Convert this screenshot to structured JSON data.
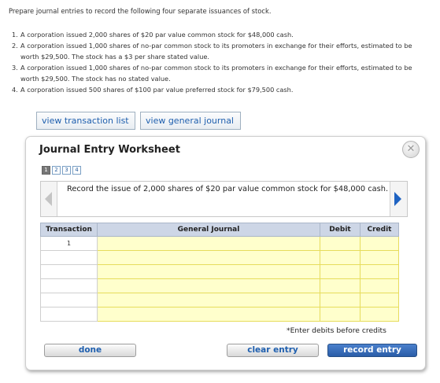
{
  "intro": "Prepare journal entries to record the following four separate issuances of stock.",
  "problems": [
    {
      "num": "1.",
      "text": "A corporation issued 2,000 shares of $20 par value common stock for $48,000 cash."
    },
    {
      "num": "2.",
      "text": "A corporation issued 1,000 shares of no-par common stock to its promoters in exchange for their efforts, estimated to be worth $29,500. The stock has a $3 per share stated value."
    },
    {
      "num": "3.",
      "text": "A corporation issued 1,000 shares of no-par common stock to its promoters in exchange for their efforts, estimated to be worth $29,500. The stock has no stated value."
    },
    {
      "num": "4.",
      "text": "A corporation issued 500 shares of $100 par value preferred stock for $79,500 cash."
    }
  ],
  "buttons": {
    "view_transaction_list": "view transaction list",
    "view_general_journal": "view general journal"
  },
  "worksheet": {
    "title": "Journal Entry Worksheet",
    "close_glyph": "✕",
    "pages": [
      "1",
      "2",
      "3",
      "4"
    ],
    "active_page": 1,
    "description": "Record the issue of 2,000 shares of $20 par value common stock for $48,000 cash.",
    "table": {
      "headers": [
        "Transaction",
        "General Journal",
        "Debit",
        "Credit"
      ],
      "rows": [
        {
          "transaction": "1",
          "account": "",
          "debit": "",
          "credit": ""
        },
        {
          "transaction": "",
          "account": "",
          "debit": "",
          "credit": ""
        },
        {
          "transaction": "",
          "account": "",
          "debit": "",
          "credit": ""
        },
        {
          "transaction": "",
          "account": "",
          "debit": "",
          "credit": ""
        },
        {
          "transaction": "",
          "account": "",
          "debit": "",
          "credit": ""
        },
        {
          "transaction": "",
          "account": "",
          "debit": "",
          "credit": ""
        }
      ]
    },
    "note": "*Enter debits before credits",
    "actions": {
      "done": "done",
      "clear_entry": "clear entry",
      "record_entry": "record entry"
    }
  },
  "colors": {
    "header_bg": "#cdd6e6",
    "input_bg": "#ffffcc",
    "link_blue": "#1f5fae",
    "primary_button": "#2a5da8"
  }
}
